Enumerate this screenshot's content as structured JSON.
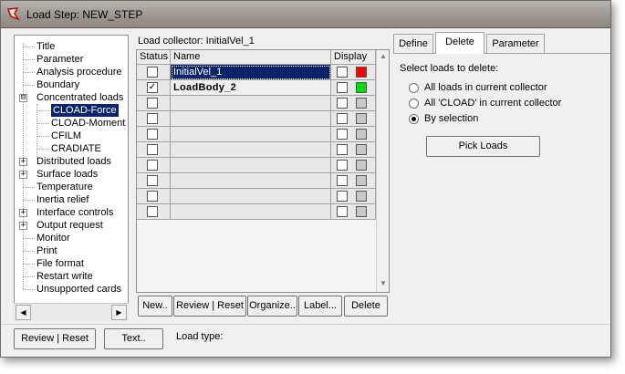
{
  "window": {
    "title": "Load Step: NEW_STEP"
  },
  "tree": {
    "items": [
      {
        "label": "Title"
      },
      {
        "label": "Parameter"
      },
      {
        "label": "Analysis procedure"
      },
      {
        "label": "Boundary"
      },
      {
        "label": "Concentrated loads",
        "expander": "⊟"
      },
      {
        "label": "CLOAD-Force"
      },
      {
        "label": "CLOAD-Moment"
      },
      {
        "label": "CFILM"
      },
      {
        "label": "CRADIATE"
      },
      {
        "label": "Distributed loads",
        "expander": "+"
      },
      {
        "label": "Surface loads",
        "expander": "+"
      },
      {
        "label": "Temperature"
      },
      {
        "label": "Inertia relief"
      },
      {
        "label": "Interface controls",
        "expander": "+"
      },
      {
        "label": "Output request",
        "expander": "+"
      },
      {
        "label": "Monitor"
      },
      {
        "label": "Print"
      },
      {
        "label": "File format"
      },
      {
        "label": "Restart write"
      },
      {
        "label": "Unsupported cards"
      }
    ],
    "selected": "CLOAD-Force"
  },
  "collector": {
    "label": "Load collector: InitialVel_1"
  },
  "grid": {
    "headers": {
      "status": "Status",
      "name": "Name",
      "display": "Display"
    },
    "rows": [
      {
        "checked": "",
        "name": "InitialVel_1",
        "color": "#ff0000",
        "selected": true
      },
      {
        "checked": "✓",
        "name": "LoadBody_2",
        "color": "#00dd00",
        "selected": false
      }
    ],
    "empty_rows": 8
  },
  "grid_buttons": {
    "new": "New..",
    "review": "Review | Reset",
    "organize": "Organize..",
    "label": "Label...",
    "delete": "Delete"
  },
  "tabs": {
    "define": "Define",
    "delete": "Delete",
    "parameter": "Parameter"
  },
  "delete_panel": {
    "prompt": "Select loads to delete:",
    "options": [
      {
        "label": "All loads in current collector",
        "selected": false
      },
      {
        "label": "All 'CLOAD' in current collector",
        "selected": false
      },
      {
        "label": "By selection",
        "selected": true
      }
    ],
    "pick_button": "Pick Loads"
  },
  "footer": {
    "review": "Review | Reset",
    "text": "Text..",
    "load_type": "Load type:"
  }
}
